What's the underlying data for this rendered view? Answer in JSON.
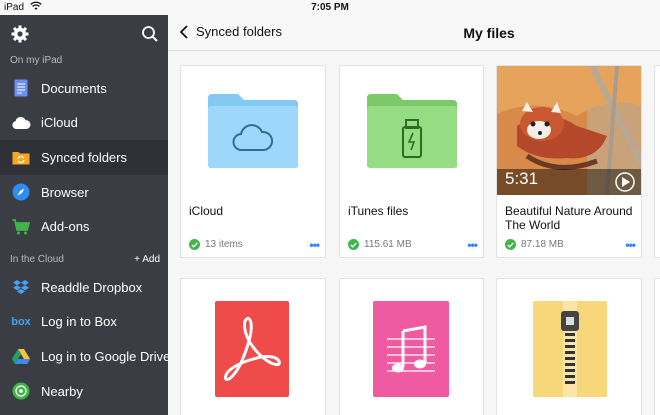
{
  "status": {
    "device": "iPad",
    "time": "7:05 PM"
  },
  "sidebar": {
    "section_local": "On my iPad",
    "local_items": [
      {
        "label": "Documents",
        "icon": "documents-icon"
      },
      {
        "label": "iCloud",
        "icon": "icloud-icon"
      },
      {
        "label": "Synced folders",
        "icon": "synced-folders-icon",
        "active": true
      },
      {
        "label": "Browser",
        "icon": "compass-icon"
      },
      {
        "label": "Add-ons",
        "icon": "cart-icon"
      }
    ],
    "section_cloud": "In the Cloud",
    "add_label": "+ Add",
    "cloud_items": [
      {
        "label": "Readdle Dropbox",
        "icon": "dropbox-icon"
      },
      {
        "label": "Log in to Box",
        "icon": "box-icon",
        "icon_text": "box"
      },
      {
        "label": "Log in to Google Drive",
        "icon": "google-drive-icon"
      },
      {
        "label": "Nearby",
        "icon": "nearby-icon"
      }
    ]
  },
  "nav": {
    "back_label": "Synced folders",
    "title": "My files"
  },
  "files": [
    {
      "name": "iCloud",
      "meta": "13 items",
      "type": "folder-cloud"
    },
    {
      "name": "iTunes files",
      "meta": "115.61 MB",
      "type": "folder-usb"
    },
    {
      "name": "Beautiful Nature Around The World",
      "meta": "87.18 MB",
      "type": "video",
      "duration": "5:31"
    },
    {
      "type": "pdf"
    },
    {
      "type": "music"
    },
    {
      "type": "zip"
    }
  ],
  "colors": {
    "sidebar_bg": "#3b3d44",
    "accent_blue": "#2f8cf0",
    "check_green": "#3fb54a"
  }
}
